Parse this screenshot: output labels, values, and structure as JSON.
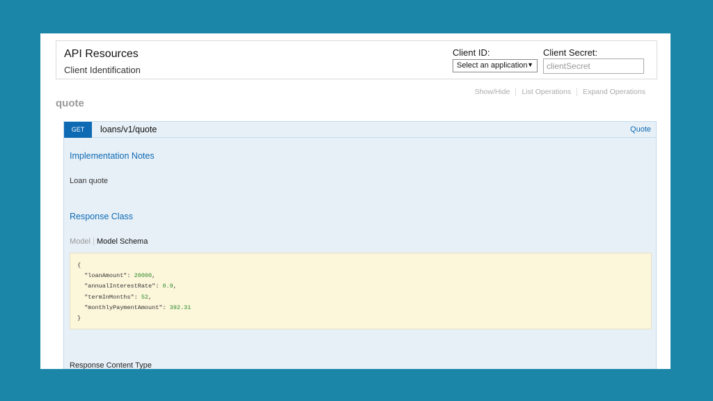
{
  "header": {
    "title": "API Resources",
    "subtitle": "Client Identification",
    "client_id_label": "Client ID:",
    "client_id_selected": "Select an application",
    "client_secret_label": "Client Secret:",
    "client_secret_placeholder": "clientSecret"
  },
  "resource": {
    "name": "quote",
    "actions": [
      "Show/Hide",
      "List Operations",
      "Expand Operations"
    ]
  },
  "operation": {
    "method": "GET",
    "path": "loans/v1/quote",
    "summary": "Quote",
    "implementation_title": "Implementation Notes",
    "implementation_text": "Loan quote",
    "response_class_title": "Response Class",
    "tabs": [
      "Model",
      "Model Schema"
    ],
    "schema": {
      "open": "{",
      "close": "}",
      "fields": [
        {
          "key": "\"loanAmount\"",
          "value": "20000"
        },
        {
          "key": "\"annualInterestRate\"",
          "value": "0.9"
        },
        {
          "key": "\"termInMonths\"",
          "value": "52"
        },
        {
          "key": "\"monthlyPaymentAmount\"",
          "value": "392.31"
        }
      ]
    },
    "response_content_type_label": "Response Content Type"
  },
  "colors": {
    "background": "#1b86a8",
    "get_badge": "#0f6ab4",
    "panel": "#e7f0f7",
    "schema_box": "#fcf6db"
  },
  "icons": [
    "dropdown-arrow-icon"
  ]
}
